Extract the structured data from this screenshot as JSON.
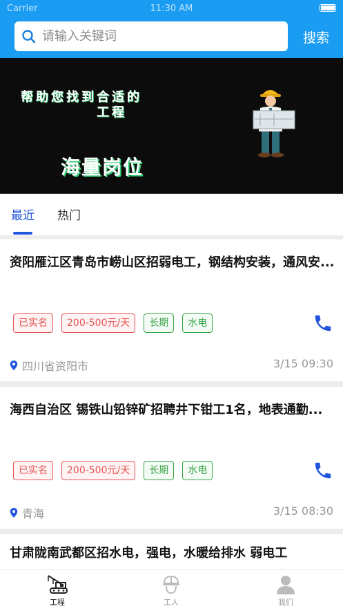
{
  "status_bar": {
    "carrier": "Carrier",
    "time": "11:30 AM"
  },
  "search": {
    "placeholder": "请输入关键词",
    "button": "搜索"
  },
  "banner": {
    "line1": "帮助您找到合适的",
    "line2": "工程",
    "slogan": "海量岗位"
  },
  "tabs": [
    {
      "label": "最近",
      "active": true
    },
    {
      "label": "热门",
      "active": false
    }
  ],
  "jobs": [
    {
      "title": "资阳雁江区青岛市崂山区招弱电工，钢结构安装，通风安...",
      "tags": [
        "已实名",
        "200-500元/天",
        "长期",
        "水电"
      ],
      "location": "四川省资阳市",
      "time": "3/15 09:30"
    },
    {
      "title": "海西自治区 锡铁山铅锌矿招聘井下钳工1名，地表通勤...",
      "tags": [
        "已实名",
        "200-500元/天",
        "长期",
        "水电"
      ],
      "location": "青海",
      "time": "3/15 08:30"
    },
    {
      "title": "甘肃陇南武都区招水电，强电，水暖给排水 弱电工"
    }
  ],
  "tabbar": [
    {
      "label": "工程",
      "active": true
    },
    {
      "label": "工人",
      "active": false
    },
    {
      "label": "我们",
      "active": false
    }
  ],
  "colors": {
    "header_blue": "#1a9cf3",
    "accent_blue": "#2255dd",
    "tag_red": "#e65454",
    "tag_green": "#38a548"
  }
}
